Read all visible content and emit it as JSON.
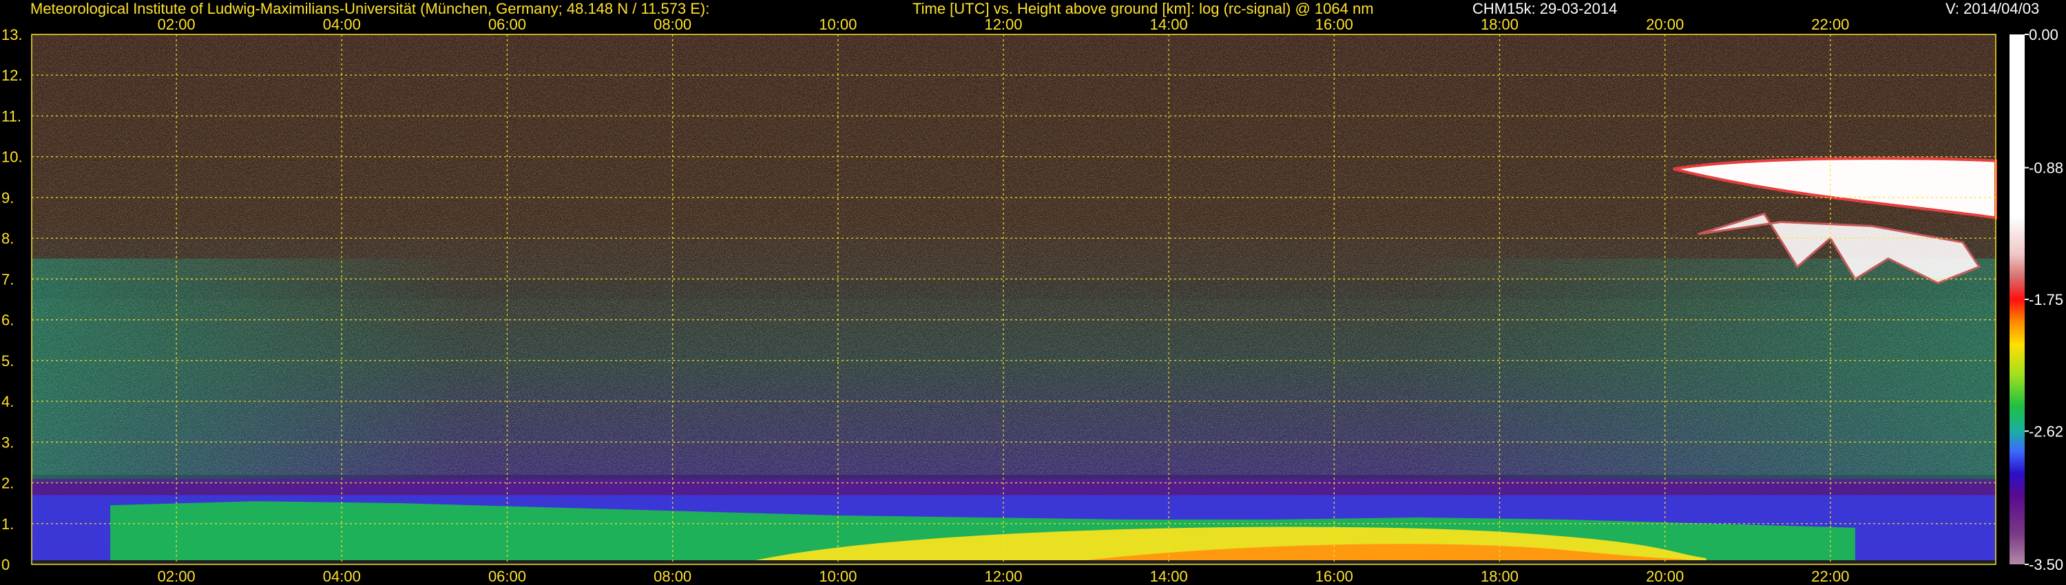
{
  "header": {
    "institute": "Meteorological Institute of Ludwig-Maximilians-Universität (München, Germany; 48.148 N / 11.573 E):",
    "axes_desc": "Time [UTC] vs. Height above ground [km]: log (rc-signal) @ 1064 nm",
    "instrument": "CHM15k: 29-03-2014",
    "version": "V: 2014/04/03"
  },
  "colors": {
    "background": "#000000",
    "text_yellow": "#ffe22a",
    "text_white": "#ffffff",
    "grid": "#ffe22a"
  },
  "chart_data": {
    "type": "heatmap",
    "title": "Time [UTC] vs. Height above ground [km]: log (rc-signal) @ 1064 nm",
    "x": {
      "unit": "UTC hour",
      "range": [
        0.25,
        24.0
      ],
      "ticks": [
        2,
        4,
        6,
        8,
        10,
        12,
        14,
        16,
        18,
        20,
        22
      ],
      "tick_labels": [
        "02:00",
        "04:00",
        "06:00",
        "08:00",
        "10:00",
        "12:00",
        "14:00",
        "16:00",
        "18:00",
        "20:00",
        "22:00"
      ]
    },
    "y": {
      "unit": "km",
      "range": [
        0,
        13
      ],
      "ticks": [
        0,
        1,
        2,
        3,
        4,
        5,
        6,
        7,
        8,
        9,
        10,
        11,
        12,
        13
      ],
      "tick_labels": [
        "0",
        "1.",
        "2.",
        "3.",
        "4.",
        "5.",
        "6.",
        "7.",
        "8.",
        "9.",
        "10.",
        "11.",
        "12.",
        "13."
      ]
    },
    "grid": true,
    "colorbar": {
      "range": [
        -3.5,
        0.0
      ],
      "tick_values": [
        0.0,
        -0.88,
        -1.75,
        -2.62,
        -3.5
      ],
      "tick_labels": [
        "0.00",
        "-0.88",
        "-1.75",
        "-2.62",
        "-3.50"
      ],
      "stops": [
        {
          "value": -3.5,
          "color": "#b38aa8"
        },
        {
          "value": -3.3,
          "color": "#7a3a86"
        },
        {
          "value": -3.05,
          "color": "#5a0a8e"
        },
        {
          "value": -2.9,
          "color": "#2a10c8"
        },
        {
          "value": -2.75,
          "color": "#3d6bff"
        },
        {
          "value": -2.62,
          "color": "#1ab0a0"
        },
        {
          "value": -2.45,
          "color": "#20c040"
        },
        {
          "value": -2.25,
          "color": "#a0e020"
        },
        {
          "value": -2.05,
          "color": "#ffe000"
        },
        {
          "value": -1.9,
          "color": "#ff8a00"
        },
        {
          "value": -1.75,
          "color": "#ff1010"
        },
        {
          "value": -1.6,
          "color": "#d87070"
        },
        {
          "value": -1.45,
          "color": "#f0c8c8"
        },
        {
          "value": -1.2,
          "color": "#ffffff"
        },
        {
          "value": 0.0,
          "color": "#ffffff"
        }
      ]
    },
    "features": [
      {
        "name": "residual layer",
        "t_start": 0.25,
        "t_end": 24.0,
        "h_bottom": 0.1,
        "h_top": 1.7
      },
      {
        "name": "boundary layer aerosol",
        "t_start": 1.2,
        "t_end": 22.3,
        "h_bottom": 0.1,
        "h_top": 1.5
      },
      {
        "name": "daytime mixing layer",
        "t_start": 9.0,
        "t_end": 20.5,
        "h_bottom": 0.1,
        "h_top": 1.0
      },
      {
        "name": "cirrus cloud",
        "t_start": 20.0,
        "t_end": 24.0,
        "h_bottom": 8.5,
        "h_top": 10.0
      },
      {
        "name": "cirrus fall streaks",
        "t_start": 20.4,
        "t_end": 23.8,
        "h_bottom": 6.8,
        "h_top": 8.5
      }
    ]
  }
}
